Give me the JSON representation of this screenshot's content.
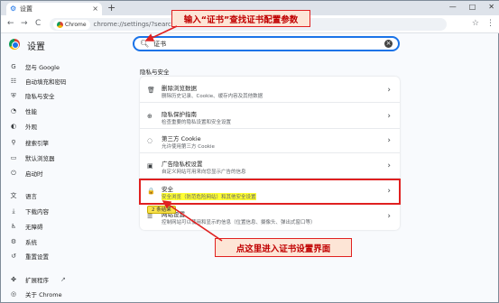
{
  "tab": {
    "title": "设置",
    "close": "×"
  },
  "newtab": "+",
  "window_controls": [
    "—",
    "□",
    "✕"
  ],
  "nav": {
    "back": "←",
    "forward": "→",
    "reload": "C"
  },
  "omnibox": {
    "chip": "Chrome",
    "url": "chrome://settings/?search=证书"
  },
  "toolbar_icons": [
    "☆",
    "⋮"
  ],
  "settings_title": "设置",
  "search": {
    "value": "证书",
    "icon": "search-icon",
    "clear": "×"
  },
  "sidebar": {
    "items": [
      {
        "label": "您与 Google",
        "icon": "G"
      },
      {
        "label": "自动填充和密码",
        "icon": "☷"
      },
      {
        "label": "隐私与安全",
        "icon": "⛨"
      },
      {
        "label": "性能",
        "icon": "◔"
      },
      {
        "label": "外观",
        "icon": "◐"
      },
      {
        "label": "搜索引擎",
        "icon": "⚲"
      },
      {
        "label": "默认浏览器",
        "icon": "▭"
      },
      {
        "label": "启动时",
        "icon": "⏻"
      },
      {
        "label": "语言",
        "icon": "文"
      },
      {
        "label": "下载内容",
        "icon": "⤓"
      },
      {
        "label": "无障碍",
        "icon": "♿"
      },
      {
        "label": "系统",
        "icon": "⚙"
      },
      {
        "label": "重置设置",
        "icon": "↺"
      },
      {
        "label": "扩展程序",
        "icon": "✤"
      },
      {
        "label": "关于 Chrome",
        "icon": "◎"
      }
    ],
    "external_link_icon": "↗"
  },
  "main": {
    "section_label": "隐私与安全",
    "rows": [
      {
        "title": "删除浏览数据",
        "desc": "删除历史记录、Cookie、缓存内容及其他数据",
        "icon": "🗑"
      },
      {
        "title": "隐私保护指南",
        "desc": "检查重要的隐私设置和安全设置",
        "icon": "⊕"
      },
      {
        "title": "第三方 Cookie",
        "desc": "允许使用第三方 Cookie",
        "icon": "◌"
      },
      {
        "title": "广告隐私权设置",
        "desc": "自定义网站可用来向您显示广告的信息",
        "icon": "▣"
      },
      {
        "title": "安全",
        "desc": "安全浏览（防范危险网站）和其他安全设置",
        "icon": "🔒"
      },
      {
        "title": "网站设置",
        "desc": "控制网站可以使用和显示的信息（位置信息、摄像头、弹出式窗口等）",
        "icon": "☰"
      }
    ],
    "arrow": "›",
    "match_badge": "2 条结果"
  },
  "annotations": {
    "top": "输入“证书”查找证书配置参数",
    "bottom": "点这里进入证书设置界面"
  },
  "colors": {
    "accent": "#1a73e8",
    "annotation": "#e02020",
    "highlight": "#ffff33"
  }
}
